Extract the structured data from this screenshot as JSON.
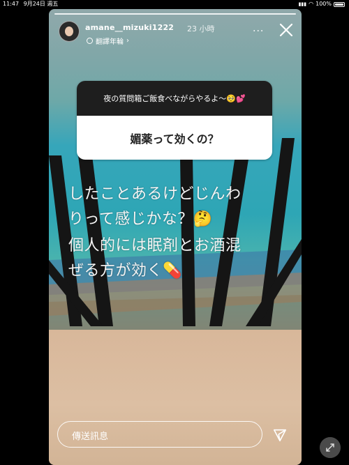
{
  "status": {
    "time": "11:47",
    "date": "9月24日 週五",
    "battery": "100%"
  },
  "story": {
    "username": "amane__mizuki1222",
    "time_ago": "23 小時",
    "translate": "翻譯年輪",
    "more": "···"
  },
  "question": {
    "header": "夜の質問箱ご飯食べながらやるよ〜🥺💕",
    "text": "媚薬って効くの？"
  },
  "answer": {
    "line1": "したことあるけどじんわ",
    "line2": "りって感じかな？🤔",
    "line3": "個人的には眠剤とお酒混",
    "line4": "ぜる方が効く💊"
  },
  "reply": {
    "placeholder": "傳送訊息"
  },
  "icons": {
    "close": "close-icon",
    "send": "send-icon",
    "more": "more-icon",
    "rotate": "rotate-icon",
    "wifi": "wifi-icon",
    "battery": "battery-icon"
  },
  "colors": {
    "question_header_bg": "#1e1e1e",
    "question_body_bg": "#ffffff",
    "sea": "#2ea6b5"
  }
}
